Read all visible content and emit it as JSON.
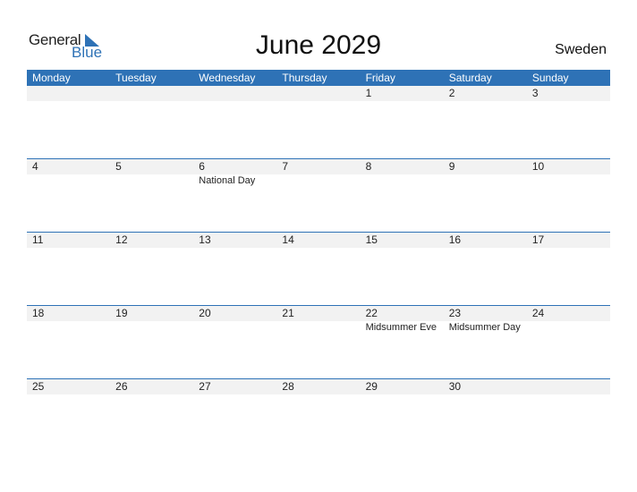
{
  "logo": {
    "general": "General",
    "blue": "Blue"
  },
  "title": "June 2029",
  "country": "Sweden",
  "weekdays": [
    "Monday",
    "Tuesday",
    "Wednesday",
    "Thursday",
    "Friday",
    "Saturday",
    "Sunday"
  ],
  "weeks": [
    {
      "days": [
        "",
        "",
        "",
        "",
        "1",
        "2",
        "3"
      ],
      "holidays": [
        "",
        "",
        "",
        "",
        "",
        "",
        ""
      ]
    },
    {
      "days": [
        "4",
        "5",
        "6",
        "7",
        "8",
        "9",
        "10"
      ],
      "holidays": [
        "",
        "",
        "National Day",
        "",
        "",
        "",
        ""
      ]
    },
    {
      "days": [
        "11",
        "12",
        "13",
        "14",
        "15",
        "16",
        "17"
      ],
      "holidays": [
        "",
        "",
        "",
        "",
        "",
        "",
        ""
      ]
    },
    {
      "days": [
        "18",
        "19",
        "20",
        "21",
        "22",
        "23",
        "24"
      ],
      "holidays": [
        "",
        "",
        "",
        "",
        "Midsummer Eve",
        "Midsummer Day",
        ""
      ]
    },
    {
      "days": [
        "25",
        "26",
        "27",
        "28",
        "29",
        "30",
        ""
      ],
      "holidays": [
        "",
        "",
        "",
        "",
        "",
        "",
        ""
      ]
    }
  ]
}
